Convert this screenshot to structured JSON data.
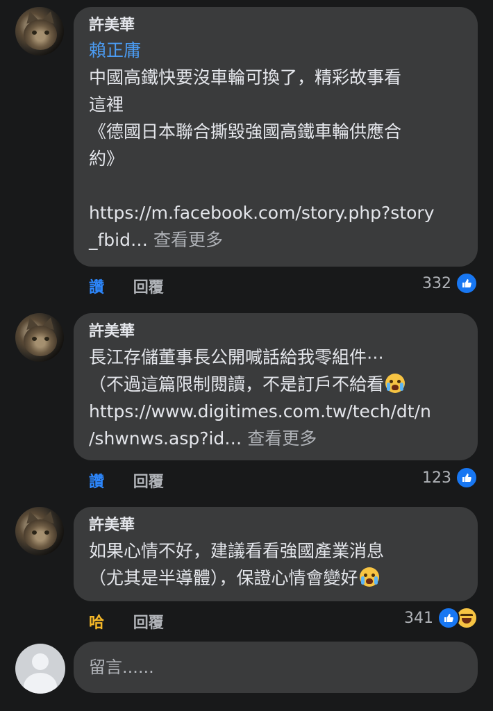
{
  "comments": [
    {
      "author": "許美華",
      "mention": "賴正庸",
      "text": "中國高鐵快要沒車輪可換了，精彩故事看\n這裡\n《德國日本聯合撕毀強國高鐵車輪供應合\n約》\n\nhttps://m.facebook.com/story.php?story\n_fbid… ",
      "see_more": "查看更多",
      "reaction_label": "讚",
      "reply_label": "回覆",
      "count": "332",
      "reaction_icons": [
        "like-icon"
      ]
    },
    {
      "author": "許美華",
      "text_a": "長江存儲董事長公開喊話給我零組件⋯\n（不過這篇限制閱讀，不是訂戶不給看",
      "text_b": "\nhttps://www.digitimes.com.tw/tech/dt/n\n/shwnws.asp?id… ",
      "see_more": "查看更多",
      "reaction_label": "讚",
      "reply_label": "回覆",
      "count": "123",
      "reaction_icons": [
        "like-icon"
      ]
    },
    {
      "author": "許美華",
      "text_a": "如果心情不好，建議看看強國產業消息\n（尤其是半導體），保證心情會變好",
      "reaction_label": "哈",
      "reply_label": "回覆",
      "count": "341",
      "reaction_icons": [
        "like-icon",
        "haha-icon"
      ]
    }
  ],
  "composer": {
    "placeholder": "留言......"
  },
  "colors": {
    "background": "#18191a",
    "bubble": "#3a3b3c",
    "mention": "#4b9cf3",
    "like": "#1877f2",
    "haha": "#f7b928"
  }
}
